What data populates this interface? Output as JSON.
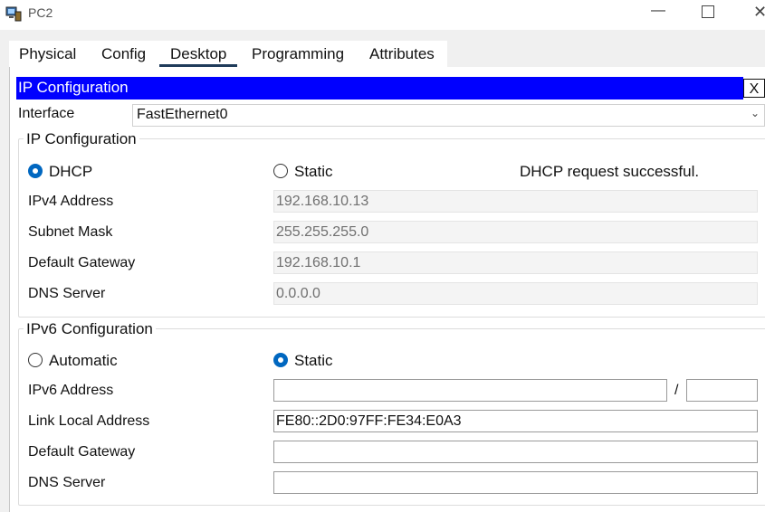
{
  "window": {
    "title": "PC2",
    "minimize_glyph": "—",
    "close_glyph": "✕"
  },
  "tabs": [
    {
      "label": "Physical"
    },
    {
      "label": "Config"
    },
    {
      "label": "Desktop",
      "active": true
    },
    {
      "label": "Programming"
    },
    {
      "label": "Attributes"
    }
  ],
  "ip_config": {
    "header": "IP Configuration",
    "close_label": "X",
    "interface_label": "Interface",
    "interface_value": "FastEthernet0",
    "ipv4": {
      "title": "IP Configuration",
      "dhcp_label": "DHCP",
      "static_label": "Static",
      "mode": "DHCP",
      "status": "DHCP request successful.",
      "ip_label": "IPv4 Address",
      "ip_value": "192.168.10.13",
      "mask_label": "Subnet Mask",
      "mask_value": "255.255.255.0",
      "gw_label": "Default Gateway",
      "gw_value": "192.168.10.1",
      "dns_label": "DNS Server",
      "dns_value": "0.0.0.0"
    },
    "ipv6": {
      "title": "IPv6 Configuration",
      "auto_label": "Automatic",
      "static_label": "Static",
      "mode": "Static",
      "addr_label": "IPv6 Address",
      "addr_value": "",
      "prefix_sep": "/",
      "prefix_value": "",
      "link_local_label": "Link Local Address",
      "link_local_value": "FE80::2D0:97FF:FE34:E0A3",
      "gw_label": "Default Gateway",
      "gw_value": "",
      "dns_label": "DNS Server",
      "dns_value": ""
    }
  },
  "colors": {
    "header_bg": "#0000ff",
    "radio_selected": "#0067c0",
    "tab_underline": "#1f3b5a"
  }
}
